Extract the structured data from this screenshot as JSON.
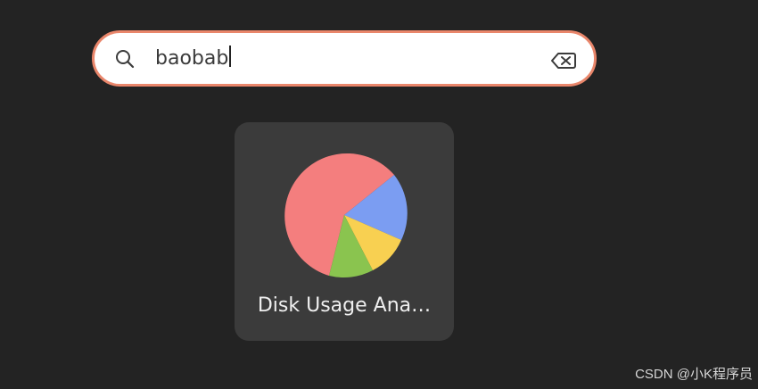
{
  "search": {
    "value": "baobab",
    "icon": "search-icon",
    "clear_icon": "backspace-clear-icon",
    "border_color": "#e9866b"
  },
  "results": [
    {
      "label": "Disk Usage Ana…",
      "icon": "disk-usage-analyzer-pie-icon",
      "icon_colors": [
        "#f47e7e",
        "#7b9df2",
        "#f8d051",
        "#8ac44f"
      ]
    }
  ],
  "watermark": "CSDN @小K程序员"
}
